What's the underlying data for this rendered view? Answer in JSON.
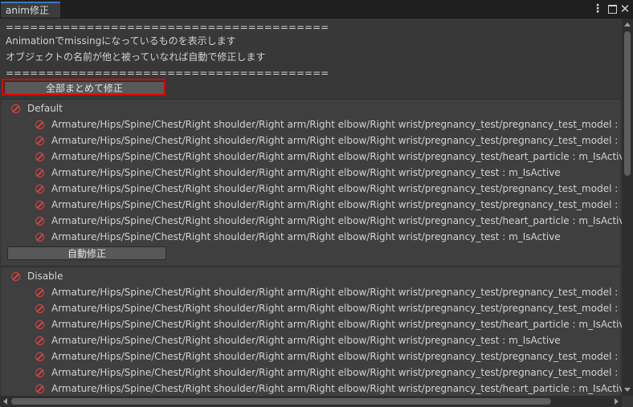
{
  "window": {
    "tab_title": "anim修正",
    "menu_glyph": "⋮",
    "close_glyph": "✕"
  },
  "header": {
    "separator_top": "========================================",
    "line1": "Animationでmissingになっているものを表示します",
    "line2": "オブジェクトの名前が他と被っていなれば自動で修正します",
    "separator_bottom": "========================================"
  },
  "fix_all_button": "全部まとめて修正",
  "sections": [
    {
      "title": "Default",
      "rows": [
        "Armature/Hips/Spine/Chest/Right shoulder/Right arm/Right elbow/Right wrist/pregnancy_test/pregnancy_test_model : blendShape",
        "Armature/Hips/Spine/Chest/Right shoulder/Right arm/Right elbow/Right wrist/pregnancy_test/pregnancy_test_model : blendShape",
        "Armature/Hips/Spine/Chest/Right shoulder/Right arm/Right elbow/Right wrist/pregnancy_test/heart_particle : m_IsActive",
        "Armature/Hips/Spine/Chest/Right shoulder/Right arm/Right elbow/Right wrist/pregnancy_test : m_IsActive",
        "Armature/Hips/Spine/Chest/Right shoulder/Right arm/Right elbow/Right wrist/pregnancy_test/pregnancy_test_model : blendShape",
        "Armature/Hips/Spine/Chest/Right shoulder/Right arm/Right elbow/Right wrist/pregnancy_test/pregnancy_test_model : blendShape",
        "Armature/Hips/Spine/Chest/Right shoulder/Right arm/Right elbow/Right wrist/pregnancy_test/heart_particle : m_IsActive",
        "Armature/Hips/Spine/Chest/Right shoulder/Right arm/Right elbow/Right wrist/pregnancy_test : m_IsActive"
      ],
      "auto_fix_label": "自動修正"
    },
    {
      "title": "Disable",
      "rows": [
        "Armature/Hips/Spine/Chest/Right shoulder/Right arm/Right elbow/Right wrist/pregnancy_test/pregnancy_test_model : blendShape",
        "Armature/Hips/Spine/Chest/Right shoulder/Right arm/Right elbow/Right wrist/pregnancy_test/pregnancy_test_model : blendShape",
        "Armature/Hips/Spine/Chest/Right shoulder/Right arm/Right elbow/Right wrist/pregnancy_test/heart_particle : m_IsActive",
        "Armature/Hips/Spine/Chest/Right shoulder/Right arm/Right elbow/Right wrist/pregnancy_test : m_IsActive",
        "Armature/Hips/Spine/Chest/Right shoulder/Right arm/Right elbow/Right wrist/pregnancy_test/pregnancy_test_model : blendShape",
        "Armature/Hips/Spine/Chest/Right shoulder/Right arm/Right elbow/Right wrist/pregnancy_test/pregnancy_test_model : blendShape",
        "Armature/Hips/Spine/Chest/Right shoulder/Right arm/Right elbow/Right wrist/pregnancy_test/heart_particle : m_IsActive"
      ]
    }
  ],
  "colors": {
    "background": "#383838",
    "tab_accent": "#3a79bb",
    "highlight": "#e00000",
    "missing_icon": "#e04040"
  },
  "icons": {
    "row_status": "missing-icon",
    "menu": "kebab-menu-icon",
    "maximize": "maximize-icon",
    "close": "close-icon"
  }
}
